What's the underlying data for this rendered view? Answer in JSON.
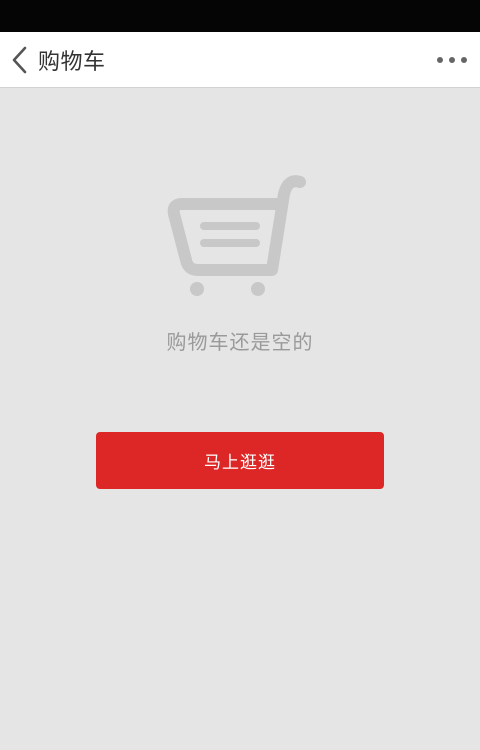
{
  "header": {
    "back_icon": "chevron-left-icon",
    "title": "购物车",
    "more_icon": "more-dots-icon"
  },
  "empty_state": {
    "icon": "shopping-cart-icon",
    "message": "购物车还是空的",
    "button_label": "马上逛逛"
  },
  "colors": {
    "status_bar": "#050505",
    "header_bg": "#ffffff",
    "page_bg": "#e5e5e6",
    "accent": "#dd2726",
    "muted_text": "#9a9a9a",
    "icon_gray": "#c8c8c8"
  }
}
